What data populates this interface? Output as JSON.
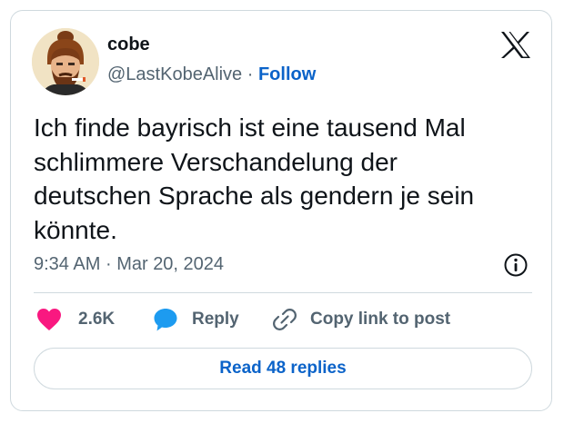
{
  "author": {
    "name": "cobe",
    "handle": "@LastKobeAlive",
    "separator": "·",
    "follow_label": "Follow"
  },
  "tweet": {
    "text": "Ich finde bayrisch ist eine tausend Mal\nschlimmere Verschandelung der\ndeutschen Sprache als gendern je sein\nkönnte.",
    "time": "9:34 AM",
    "separator": "·",
    "date": "Mar 20, 2024"
  },
  "actions": {
    "like_count": "2.6K",
    "reply_label": "Reply",
    "copy_label": "Copy link to post"
  },
  "read_replies_label": "Read 48 replies",
  "icons": {
    "logo": "x-logo-icon",
    "info": "info-icon",
    "like": "heart-icon",
    "reply": "speech-bubble-icon",
    "copy": "link-icon"
  },
  "colors": {
    "heart": "#f91880",
    "reply_bubble": "#1d9bf0",
    "follow": "#0b63c9",
    "secondary_text": "#536471",
    "border": "#cfd9de"
  }
}
